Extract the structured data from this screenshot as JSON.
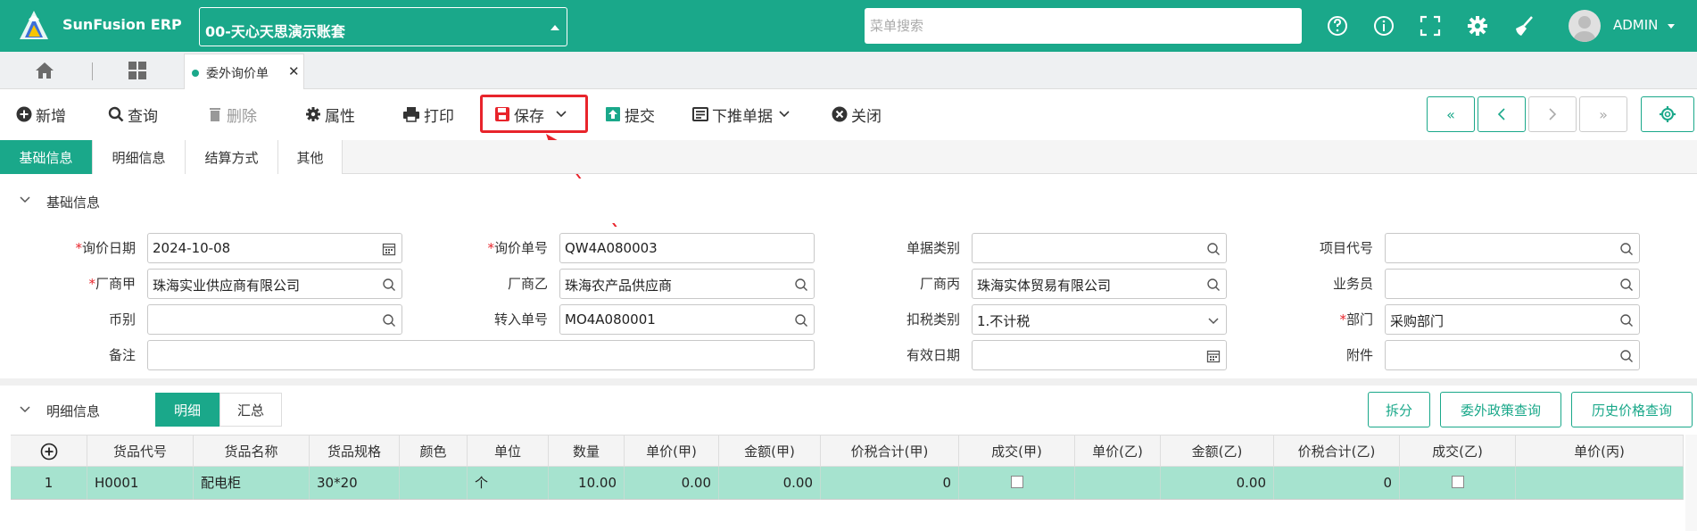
{
  "app": {
    "name": "SunFusion ERP",
    "company": "00-天心天思演示账套",
    "user": "ADMIN"
  },
  "search": {
    "placeholder": "菜单搜索"
  },
  "tabs": {
    "doc_tab": "委外询价单"
  },
  "toolbar": {
    "new": "新增",
    "query": "查询",
    "delete": "删除",
    "props": "属性",
    "print": "打印",
    "save": "保存",
    "submit": "提交",
    "push": "下推单据",
    "close": "关闭"
  },
  "section_tabs": [
    "基础信息",
    "明细信息",
    "结算方式",
    "其他"
  ],
  "base_section": {
    "title": "基础信息"
  },
  "form": {
    "inquiry_date": {
      "label": "询价日期",
      "value": "2024-10-08"
    },
    "inquiry_no": {
      "label": "询价单号",
      "value": "QW4A080003"
    },
    "doc_type": {
      "label": "单据类别",
      "value": ""
    },
    "project_code": {
      "label": "项目代号",
      "value": ""
    },
    "vendor_a": {
      "label": "厂商甲",
      "value": "珠海实业供应商有限公司"
    },
    "vendor_b": {
      "label": "厂商乙",
      "value": "珠海农产品供应商"
    },
    "vendor_c": {
      "label": "厂商丙",
      "value": "珠海实体贸易有限公司"
    },
    "salesman": {
      "label": "业务员",
      "value": ""
    },
    "currency": {
      "label": "币别",
      "value": ""
    },
    "transfer_no": {
      "label": "转入单号",
      "value": "MO4A080001"
    },
    "tax_type": {
      "label": "扣税类别",
      "value": "1.不计税"
    },
    "department": {
      "label": "部门",
      "value": "采购部门"
    },
    "remark": {
      "label": "备注",
      "value": ""
    },
    "valid_date": {
      "label": "有效日期",
      "value": ""
    },
    "attachment": {
      "label": "附件",
      "value": ""
    }
  },
  "detail": {
    "title": "明细信息",
    "tabs": [
      "明细",
      "汇总"
    ],
    "buttons": {
      "split": "拆分",
      "outsource_policy": "委外政策查询",
      "history_price": "历史价格查询"
    },
    "columns": [
      "货品代号",
      "货品名称",
      "货品规格",
      "颜色",
      "单位",
      "数量",
      "单价(甲)",
      "金额(甲)",
      "价税合计(甲)",
      "成交(甲)",
      "单价(乙)",
      "金额(乙)",
      "价税合计(乙)",
      "成交(乙)",
      "单价(丙)"
    ],
    "rows": [
      {
        "no": "1",
        "code": "H0001",
        "name": "配电柜",
        "spec": "30*20",
        "color": "",
        "unit": "个",
        "qty": "10.00",
        "price_a": "0.00",
        "amount_a": "0.00",
        "total_a": "0",
        "price_b": "",
        "amount_b": "0.00",
        "total_b": "0",
        "price_c": ""
      }
    ]
  },
  "colors": {
    "accent": "#1aa88a",
    "highlight": "#e8242b",
    "row_selected": "#a6e3cf"
  }
}
